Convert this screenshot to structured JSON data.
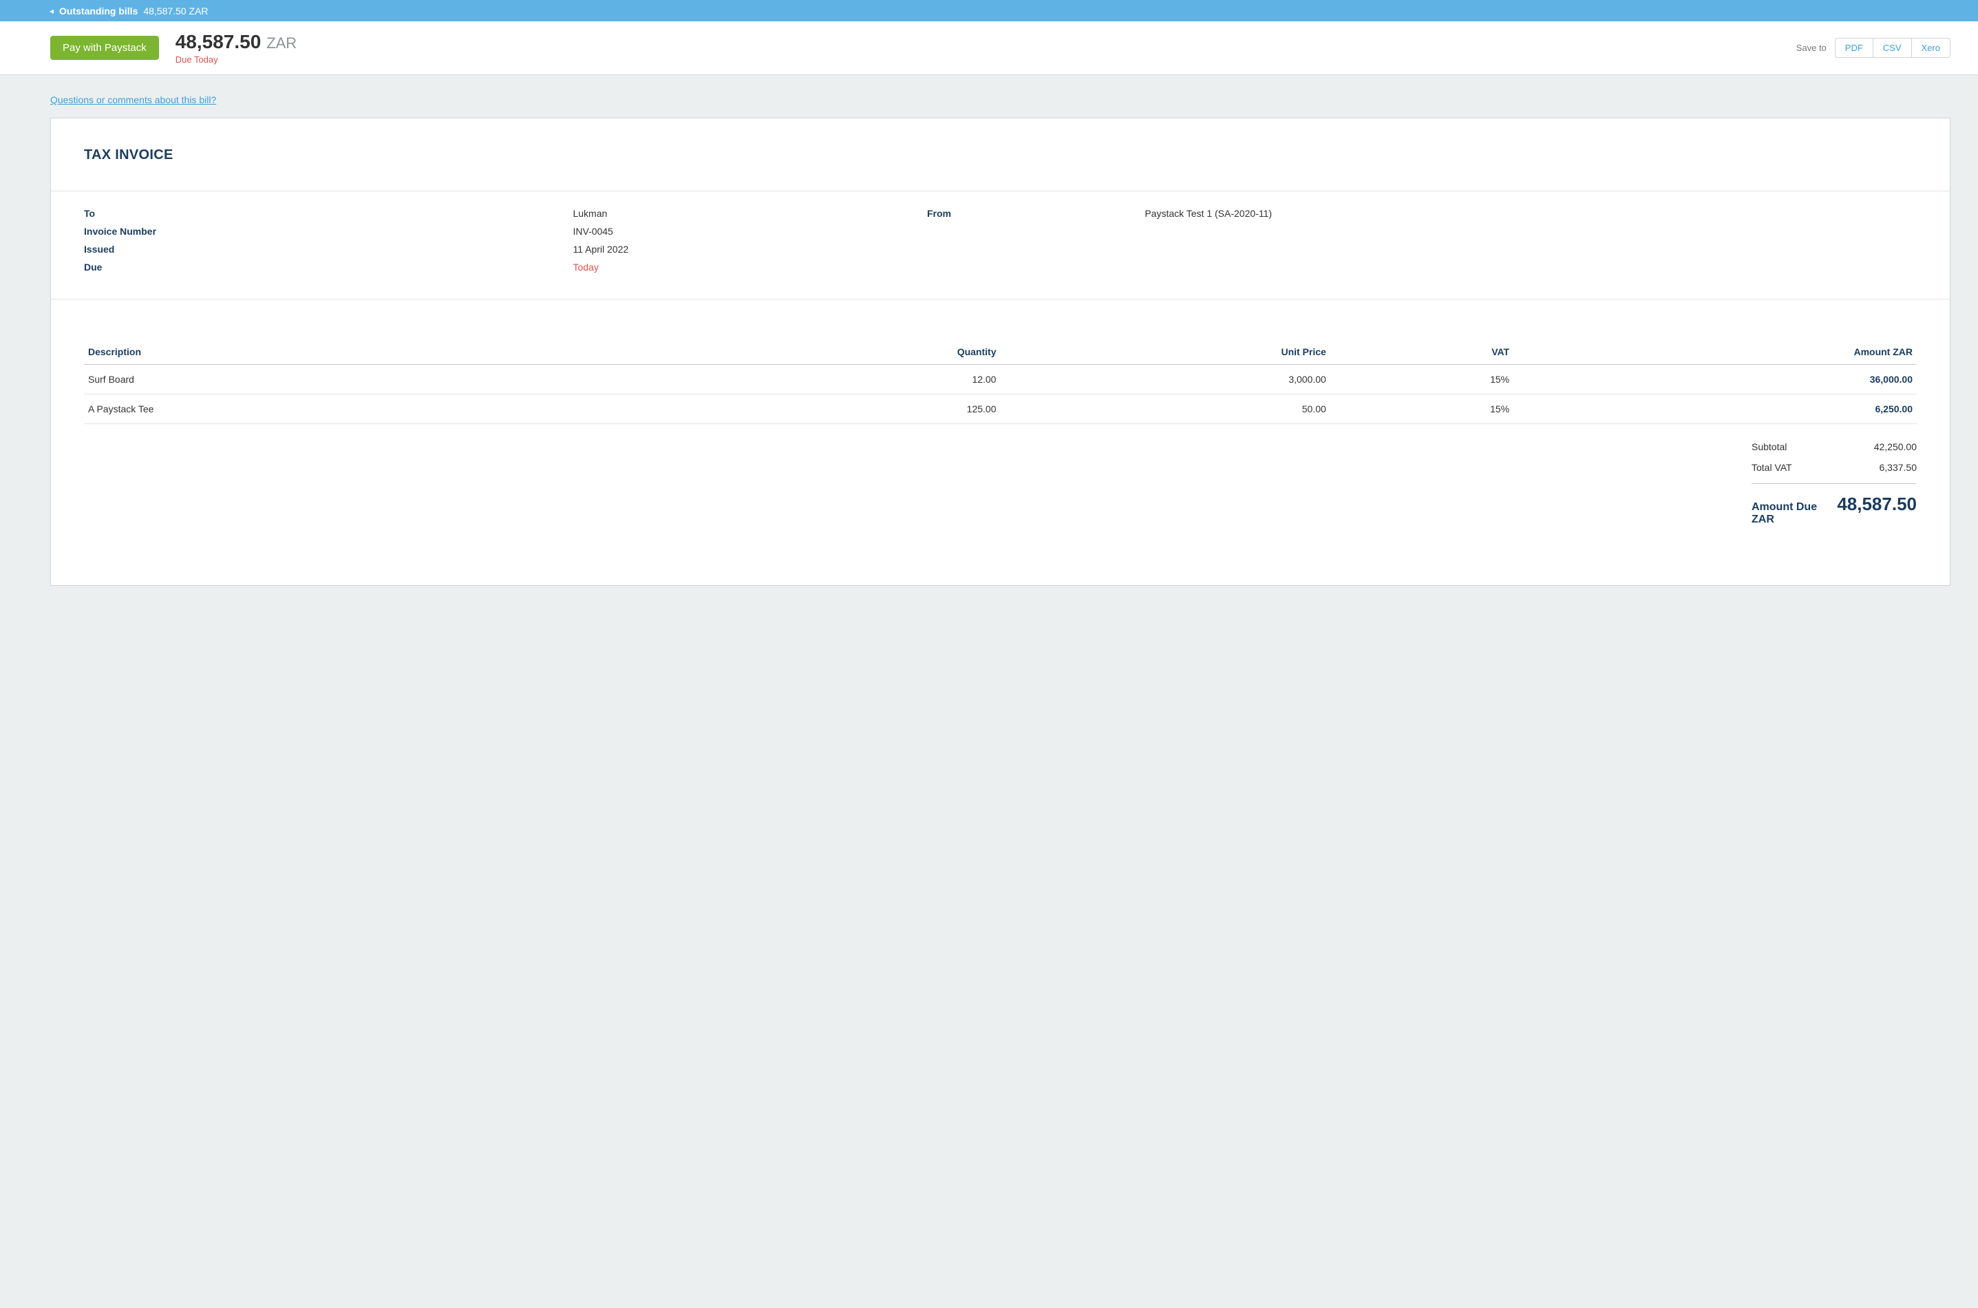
{
  "topbar": {
    "caret": "◂",
    "label": "Outstanding bills",
    "amount": "48,587.50 ZAR"
  },
  "actionbar": {
    "pay_button": "Pay with Paystack",
    "amount": "48,587.50",
    "currency": "ZAR",
    "due_label": "Due Today",
    "save_to_label": "Save to",
    "buttons": {
      "pdf": "PDF",
      "csv": "CSV",
      "xero": "Xero"
    }
  },
  "question_link": "Questions or comments about this bill?",
  "invoice": {
    "title": "TAX INVOICE",
    "meta": {
      "to_label": "To",
      "to_value": "Lukman",
      "number_label": "Invoice Number",
      "number_value": "INV-0045",
      "issued_label": "Issued",
      "issued_value": "11 April 2022",
      "due_label": "Due",
      "due_value": "Today",
      "from_label": "From",
      "from_value": "Paystack Test 1 (SA-2020-11)"
    },
    "columns": {
      "description": "Description",
      "quantity": "Quantity",
      "unit_price": "Unit Price",
      "vat": "VAT",
      "amount": "Amount ZAR"
    },
    "items": [
      {
        "description": "Surf Board",
        "quantity": "12.00",
        "unit_price": "3,000.00",
        "vat": "15%",
        "amount": "36,000.00"
      },
      {
        "description": "A Paystack Tee",
        "quantity": "125.00",
        "unit_price": "50.00",
        "vat": "15%",
        "amount": "6,250.00"
      }
    ],
    "totals": {
      "subtotal_label": "Subtotal",
      "subtotal_value": "42,250.00",
      "vat_label": "Total VAT",
      "vat_value": "6,337.50",
      "due_label": "Amount Due ZAR",
      "due_value": "48,587.50"
    }
  }
}
